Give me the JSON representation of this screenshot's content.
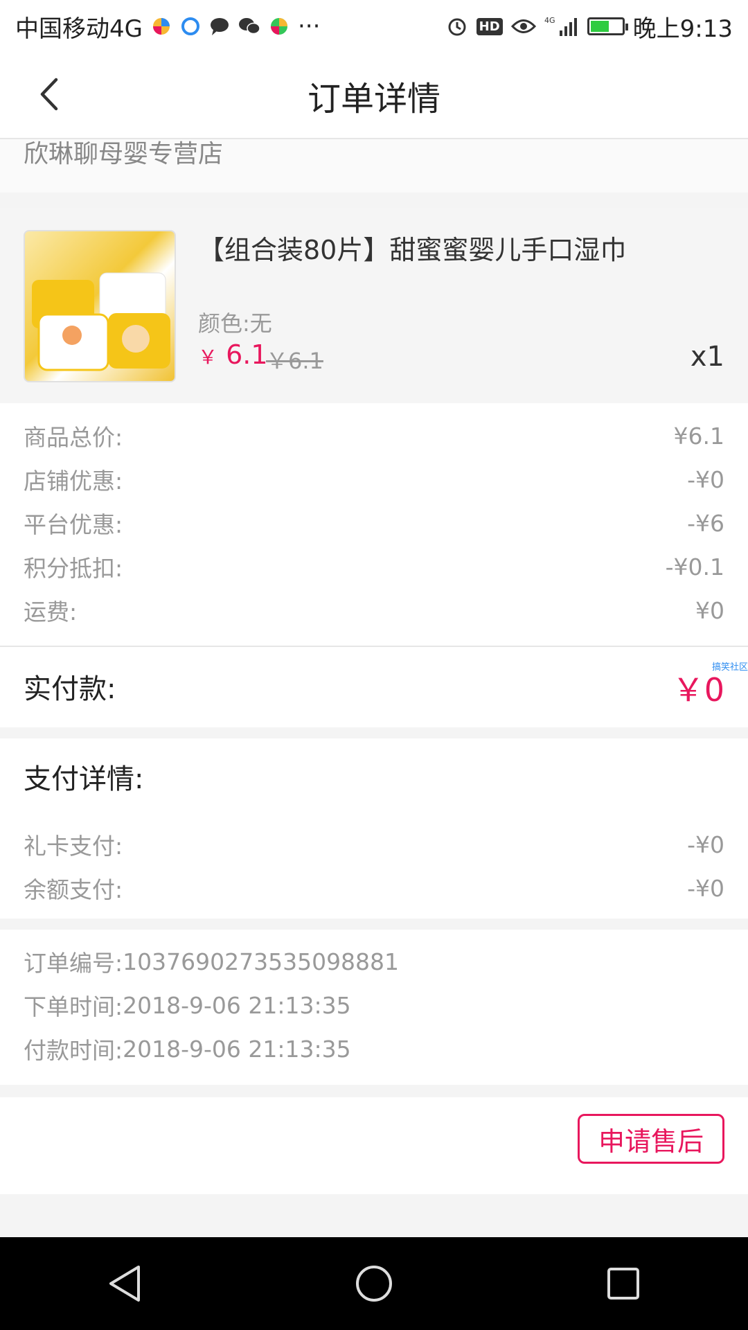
{
  "statusbar": {
    "carrier": "中国移动4G",
    "more": "···",
    "network": "4G",
    "time": "晚上9:13"
  },
  "header": {
    "title": "订单详情"
  },
  "shop": {
    "name": "欣琳聊母婴专营店"
  },
  "product": {
    "title": "【组合装80片】甜蜜蜜婴儿手口湿巾",
    "spec": "颜色:无",
    "price_symbol": "￥",
    "price": "6.1",
    "original_price": "￥6.1",
    "quantity": "x1"
  },
  "summary": [
    {
      "label": "商品总价:",
      "value": "¥6.1"
    },
    {
      "label": "店铺优惠:",
      "value": "-¥0"
    },
    {
      "label": "平台优惠:",
      "value": "-¥6"
    },
    {
      "label": "积分抵扣:",
      "value": "-¥0.1"
    },
    {
      "label": "运费:",
      "value": "¥0"
    }
  ],
  "total": {
    "label": "实付款:",
    "value": "￥0",
    "watermark": "搞笑社区"
  },
  "payment": {
    "heading": "支付详情:",
    "rows": [
      {
        "label": "礼卡支付:",
        "value": "-¥0"
      },
      {
        "label": "余额支付:",
        "value": "-¥0"
      }
    ]
  },
  "order_info": [
    {
      "label": "订单编号:",
      "value": "1037690273535098881"
    },
    {
      "label": "下单时间:",
      "value": "2018-9-06 21:13:35"
    },
    {
      "label": "付款时间:",
      "value": "2018-9-06 21:13:35"
    }
  ],
  "actions": {
    "aftersale": "申请售后"
  },
  "colors": {
    "accent": "#e8175d",
    "muted": "#999999",
    "page_bg": "#f4f4f4",
    "navbar": "#000000"
  }
}
